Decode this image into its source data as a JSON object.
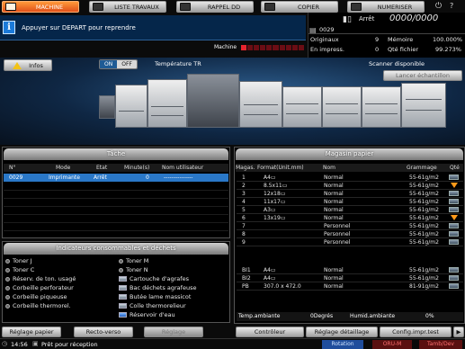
{
  "tabs": [
    {
      "label": "MACHINE",
      "icon": "machine-icon",
      "active": true
    },
    {
      "label": "LISTE TRAVAUX",
      "icon": "job-list-icon",
      "active": false
    },
    {
      "label": "RAPPEL DD",
      "icon": "hdd-recall-icon",
      "active": false
    },
    {
      "label": "COPIER",
      "icon": "copy-icon",
      "active": false
    },
    {
      "label": "NUMERISER",
      "icon": "scan-icon",
      "active": false
    }
  ],
  "message": {
    "icon": "info-icon",
    "text": "Appuyer sur DEPART pour reprendre"
  },
  "status_panel": {
    "state": "Arrêt",
    "counter": "0000/0000",
    "job_number": "0029",
    "originaux_label": "Originaux",
    "originaux_value": "9",
    "memoire_label": "Mémoire",
    "memoire_value": "100.000%",
    "en_impress_label": "En impress.",
    "en_impress_value": "0",
    "qte_fichier_label": "Qté fichier",
    "qte_fichier_value": "99.273%"
  },
  "machine_label": "Machine",
  "machine_level_bars": 10,
  "machine_level_filled": 1,
  "info_button": "Infos",
  "toggle": {
    "on": "ON",
    "off": "OFF"
  },
  "temperature_label": "Température TR",
  "scanner_status": "Scanner disponible",
  "lancer_echantillon": "Lancer échantillon",
  "tache": {
    "title": "Tâche",
    "headers": [
      "N°",
      "Mode",
      "Etat",
      "Minute(s)",
      "Nom utilisateur"
    ],
    "rows": [
      [
        "0029",
        "Imprimante",
        "Arrêt",
        "0",
        "---------------"
      ]
    ]
  },
  "consumables": {
    "title": "Indicateurs consommables et déchets",
    "left": [
      "Toner J",
      "Toner C",
      "Réserv. de ton. usagé",
      "Corbeille perforateur",
      "Corbeille piqueuse",
      "Corbeille thermorel."
    ],
    "right": [
      "Toner M",
      "Toner N",
      "Cartouche d'agrafes",
      "Bac déchets agrafeuse",
      "Butée lame massicot",
      "Colle thermorelieur",
      "Réservoir d'eau"
    ]
  },
  "magasin": {
    "title": "Magasin papier",
    "headers": [
      "Magas.",
      "Format(Unit.mm)",
      "Nom",
      "Grammage",
      "Qté"
    ],
    "rows": [
      {
        "magas": "1",
        "format": "A4▭",
        "nom": "Normal",
        "grammage": "55-61g/m2",
        "low": false
      },
      {
        "magas": "2",
        "format": "8.5x11▭",
        "nom": "Normal",
        "grammage": "55-61g/m2",
        "low": true
      },
      {
        "magas": "3",
        "format": "12x18▭",
        "nom": "Normal",
        "grammage": "55-61g/m2",
        "low": false
      },
      {
        "magas": "4",
        "format": "11x17▭",
        "nom": "Normal",
        "grammage": "55-61g/m2",
        "low": false
      },
      {
        "magas": "5",
        "format": "A3▭",
        "nom": "Normal",
        "grammage": "55-61g/m2",
        "low": false
      },
      {
        "magas": "6",
        "format": "13x19▭",
        "nom": "Normal",
        "grammage": "55-61g/m2",
        "low": true
      },
      {
        "magas": "7",
        "format": "",
        "nom": "Personnel",
        "grammage": "55-61g/m2",
        "low": false
      },
      {
        "magas": "8",
        "format": "",
        "nom": "Personnel",
        "grammage": "55-61g/m2",
        "low": false
      },
      {
        "magas": "9",
        "format": "",
        "nom": "Personnel",
        "grammage": "55-61g/m2",
        "low": false
      },
      {
        "magas": "BI1",
        "format": "A4▭",
        "nom": "Normal",
        "grammage": "55-61g/m2",
        "low": false
      },
      {
        "magas": "BI2",
        "format": "A4▭",
        "nom": "Normal",
        "grammage": "55-61g/m2",
        "low": false
      },
      {
        "magas": "PB",
        "format": "307.0 x 472.0",
        "nom": "Normal",
        "grammage": "81-91g/m2",
        "low": false
      }
    ],
    "temp_label": "Temp.ambiante",
    "temp_value": "0Degrés",
    "humid_label": "Humid.ambiante",
    "humid_value": "0%"
  },
  "bottom_buttons": [
    "Réglage papier",
    "Recto-verso",
    "Réglage",
    "Contrôleur",
    "Réglage détaillage",
    "Config.impr.test"
  ],
  "statusbar": {
    "time": "14:56",
    "status": "Prêt pour réception",
    "rotation": "Rotation",
    "oru": "ORU-M",
    "tamb": "Tamb/Dev"
  }
}
